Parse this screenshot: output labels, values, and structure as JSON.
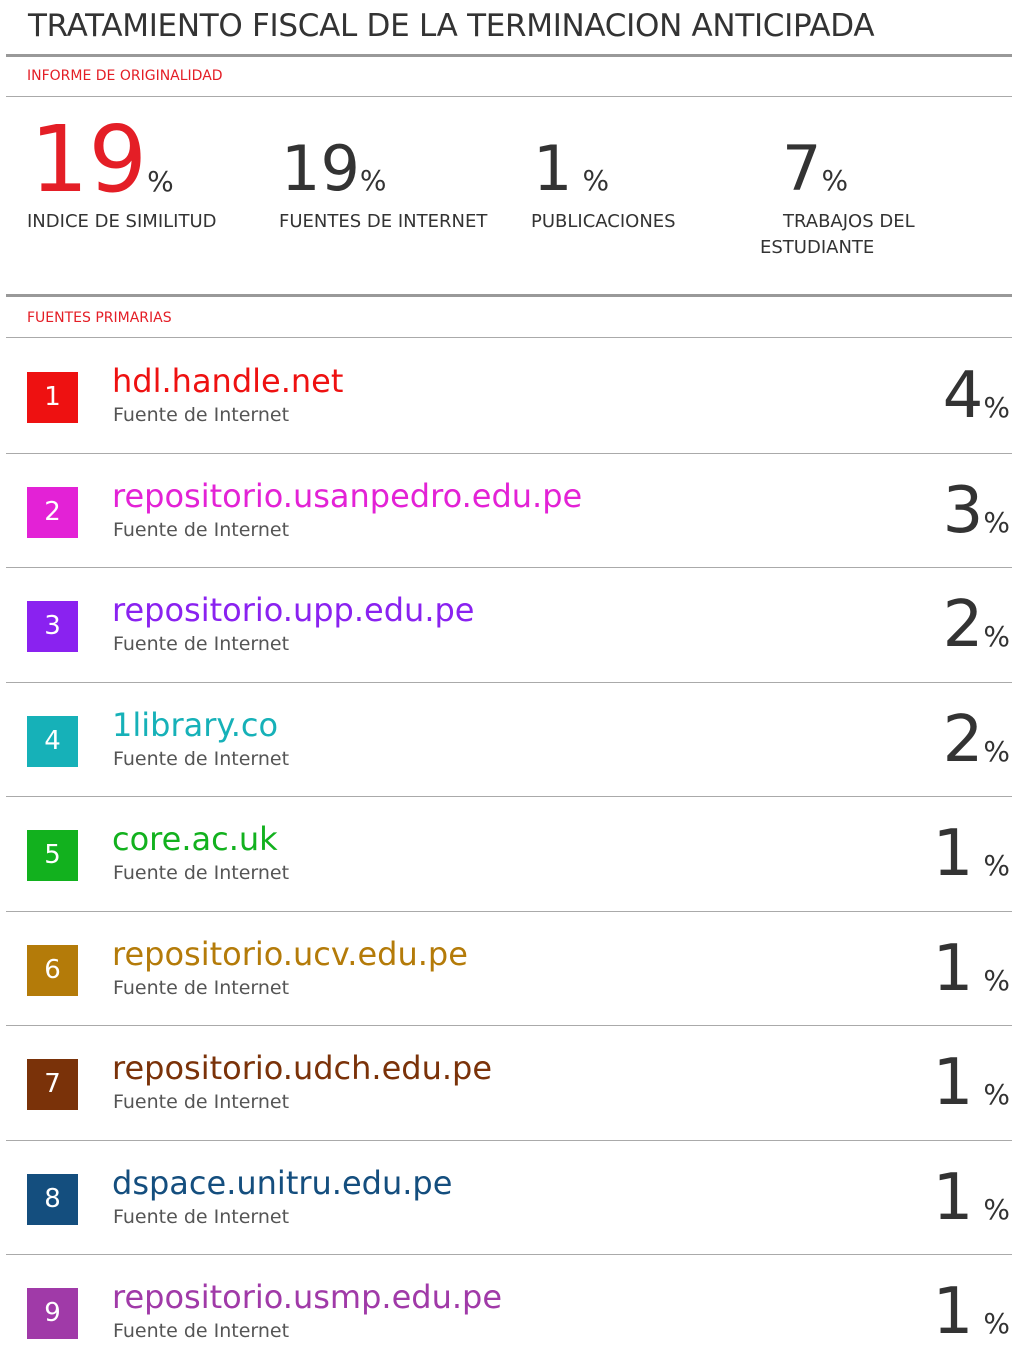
{
  "title": "TRATAMIENTO FISCAL DE LA TERMINACION ANTICIPADA",
  "originality_label": "INFORME DE ORIGINALIDAD",
  "stats": {
    "similarity": {
      "value": "19",
      "unit": "%",
      "label": "INDICE DE SIMILITUD"
    },
    "internet": {
      "value": "19",
      "unit": "%",
      "label": "FUENTES DE INTERNET"
    },
    "publications": {
      "value": "1",
      "unit": "%",
      "label": "PUBLICACIONES"
    },
    "student": {
      "value": "7",
      "unit": "%",
      "label_line1": "TRABAJOS DEL",
      "label_line2": "ESTUDIANTE"
    }
  },
  "primary_label": "FUENTES PRIMARIAS",
  "sources": [
    {
      "rank": "1",
      "name": "hdl.handle.net",
      "type": "Fuente de Internet",
      "percent": "4",
      "unit": "%",
      "color": "#ee1111"
    },
    {
      "rank": "2",
      "name": "repositorio.usanpedro.edu.pe",
      "type": "Fuente de Internet",
      "percent": "3",
      "unit": "%",
      "color": "#e322d6"
    },
    {
      "rank": "3",
      "name": "repositorio.upp.edu.pe",
      "type": "Fuente de Internet",
      "percent": "2",
      "unit": "%",
      "color": "#8a22f0"
    },
    {
      "rank": "4",
      "name": "1library.co",
      "type": "Fuente de Internet",
      "percent": "2",
      "unit": "%",
      "color": "#16b1b8"
    },
    {
      "rank": "5",
      "name": "core.ac.uk",
      "type": "Fuente de Internet",
      "percent": "1",
      "unit": "%",
      "color": "#12b11e"
    },
    {
      "rank": "6",
      "name": "repositorio.ucv.edu.pe",
      "type": "Fuente de Internet",
      "percent": "1",
      "unit": "%",
      "color": "#b47b09"
    },
    {
      "rank": "7",
      "name": "repositorio.udch.edu.pe",
      "type": "Fuente de Internet",
      "percent": "1",
      "unit": "%",
      "color": "#7a3209"
    },
    {
      "rank": "8",
      "name": "dspace.unitru.edu.pe",
      "type": "Fuente de Internet",
      "percent": "1",
      "unit": "%",
      "color": "#144e7e"
    },
    {
      "rank": "9",
      "name": "repositorio.usmp.edu.pe",
      "type": "Fuente de Internet",
      "percent": "1",
      "unit": "%",
      "color": "#a03aa8"
    }
  ]
}
